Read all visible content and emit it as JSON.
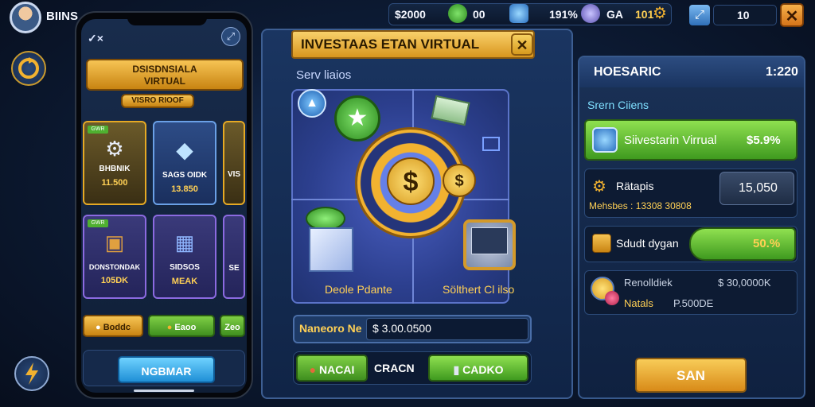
{
  "player": {
    "name": "BIINS"
  },
  "topbar": {
    "cash": "$2000",
    "gems": "00",
    "percent": "191%",
    "ga": "GA",
    "gold": "101",
    "count": "10"
  },
  "phone": {
    "close_label": "✓×",
    "banner_title": "DSISDNSIALA\nVIRTUAL",
    "sub_banner": "VISRO RIOOF",
    "cards": [
      {
        "label": "BHBNIK",
        "value": "11.500",
        "tag": "GWR"
      },
      {
        "label": "SAGS OIDK",
        "value": "13.850",
        "tag": ""
      },
      {
        "label": "VIS",
        "value": "",
        "tag": ""
      },
      {
        "label": "DONSTONDAK",
        "value": "105DK",
        "tag": "GWR"
      },
      {
        "label": "SIDSOS",
        "value": "MEAK",
        "tag": ""
      },
      {
        "label": "SE",
        "value": "",
        "tag": ""
      }
    ],
    "pills": [
      "Boddc",
      "Eaoo",
      "Zeo"
    ],
    "main_button": "NGBMAR"
  },
  "center": {
    "title": "INVESTAAS ETAN VIRTUAL",
    "section_label": "Serv liaios",
    "left_caption": "Deole Pdante",
    "right_caption": "Sölthert Cl ilso",
    "input_label": "Naneoro Ne",
    "input_value": "$ 3.00.0500",
    "left_button": "NACAI",
    "middle_button": "CRACN",
    "right_button": "CADKO"
  },
  "right": {
    "title": "HOESARIC",
    "title_value": "1:220",
    "section_label": "Srern Ciiens",
    "row1": {
      "label": "Siivestarin Virrual",
      "value": "$5.9%"
    },
    "row2": {
      "label": "Rätapis",
      "value": "15,050",
      "sub": "Mehsbes : 13308 30808"
    },
    "row3": {
      "label": "Sdudt dygan",
      "value": "50.%"
    },
    "row4": {
      "label": "Renolldiek",
      "value": "$ 30,0000K",
      "sub_label": "Natals",
      "sub_value": "P.500DE"
    },
    "button": "SAN"
  },
  "colors": {
    "gold": "#f2b230",
    "green": "#5fb530",
    "panel": "#1a3561",
    "close": "#e8962a"
  }
}
